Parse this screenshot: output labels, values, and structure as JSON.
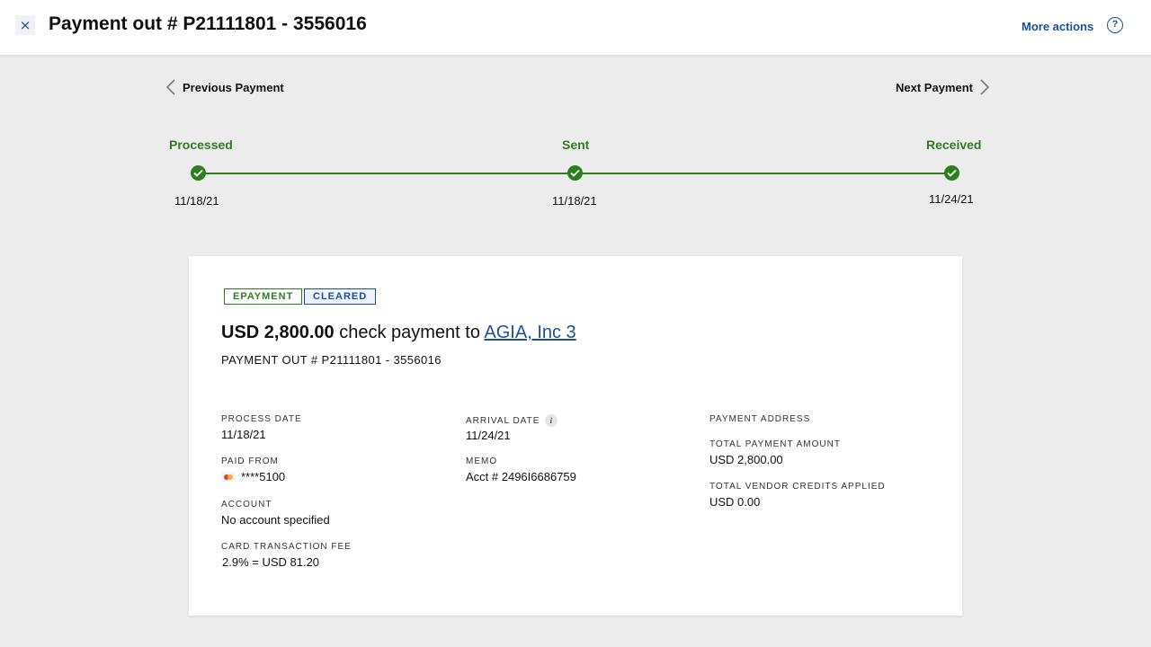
{
  "header": {
    "close_icon": "×",
    "title": "Payment out # P21111801 - 3556016",
    "more_actions": "More actions",
    "help_icon": "?"
  },
  "nav": {
    "previous": "Previous Payment",
    "next": "Next Payment"
  },
  "timeline": {
    "steps": [
      {
        "label": "Processed",
        "date": "11/18/21",
        "status": "complete"
      },
      {
        "label": "Sent",
        "date": "11/18/21",
        "status": "complete"
      },
      {
        "label": "Received",
        "date": "11/24/21",
        "status": "complete"
      }
    ]
  },
  "card": {
    "badges": [
      "EPAYMENT",
      "CLEARED"
    ],
    "headline": {
      "amount": "USD 2,800.00",
      "text": " check payment to ",
      "payee": "AGIA, Inc 3"
    },
    "subline": "PAYMENT OUT # P21111801 - 3556016",
    "fields": {
      "process_date": {
        "label": "PROCESS DATE",
        "value": "11/18/21"
      },
      "paid_from": {
        "label": "PAID FROM",
        "value": "****5100"
      },
      "account": {
        "label": "ACCOUNT",
        "value": "No account specified"
      },
      "card_fee": {
        "label": "CARD TRANSACTION FEE",
        "value": "2.9% = USD 81.20"
      },
      "arrival_date": {
        "label": "ARRIVAL DATE",
        "value": "11/24/21",
        "info_icon": "i"
      },
      "memo": {
        "label": "MEMO",
        "value": "Acct # 2496I6686759"
      },
      "payment_address": {
        "label": "PAYMENT ADDRESS"
      },
      "total_payment": {
        "label": "TOTAL PAYMENT AMOUNT",
        "value": "USD 2,800.00"
      },
      "total_credits": {
        "label": "TOTAL VENDOR CREDITS APPLIED",
        "value": "USD 0.00"
      }
    }
  },
  "colors": {
    "accent_blue": "#1a4f9a",
    "success_green": "#2e7d1f",
    "background": "#ececec"
  }
}
